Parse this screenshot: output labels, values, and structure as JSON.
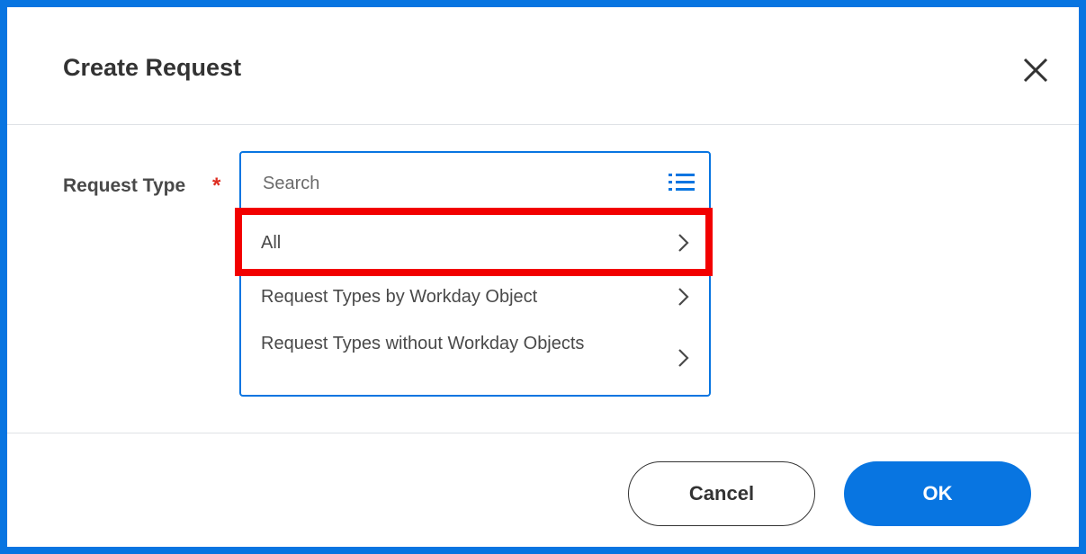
{
  "dialog": {
    "title": "Create Request",
    "close_icon": "close-icon"
  },
  "form": {
    "request_type_label": "Request Type",
    "required_marker": "*",
    "search_placeholder": "Search",
    "list_icon": "list-icon",
    "options": [
      {
        "label": "All",
        "icon": "chevron-right-icon",
        "highlighted": true
      },
      {
        "label": "Request Types by Workday Object",
        "icon": "chevron-right-icon"
      },
      {
        "label": "Request Types without Workday Objects",
        "icon": "chevron-right-icon"
      }
    ]
  },
  "footer": {
    "cancel_label": "Cancel",
    "ok_label": "OK"
  },
  "colors": {
    "frame": "#0875e1",
    "accent": "#0875e1",
    "required": "#de2e21",
    "highlight": "#f20000"
  }
}
